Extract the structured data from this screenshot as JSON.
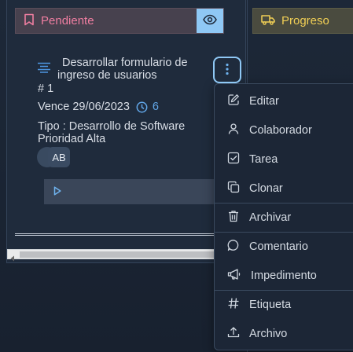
{
  "columns": {
    "pending": {
      "label": "Pendiente",
      "accent": "#f07ea1"
    },
    "progress": {
      "label": "Progreso",
      "accent": "#f1cf55"
    }
  },
  "task": {
    "title_line1": "Desarrollar formulario de",
    "title_line2": "ingreso de usuarios",
    "number": "# 1",
    "due": "Vence 29/06/2023",
    "time_count": "6",
    "type": "Tipo : Desarrollo de Software",
    "priority": "Prioridad Alta",
    "avatar_initials": "AB"
  },
  "menu": {
    "items": [
      {
        "label": "Editar",
        "icon": "edit-icon"
      },
      {
        "label": "Colaborador",
        "icon": "user-icon"
      },
      {
        "label": "Tarea",
        "icon": "checkbox-icon"
      },
      {
        "label": "Clonar",
        "icon": "copy-icon"
      },
      {
        "label": "Archivar",
        "icon": "trash-icon"
      },
      {
        "label": "Comentario",
        "icon": "comment-icon"
      },
      {
        "label": "Impedimento",
        "icon": "megaphone-icon"
      },
      {
        "label": "Etiqueta",
        "icon": "hash-icon"
      },
      {
        "label": "Archivo",
        "icon": "upload-icon"
      }
    ]
  }
}
